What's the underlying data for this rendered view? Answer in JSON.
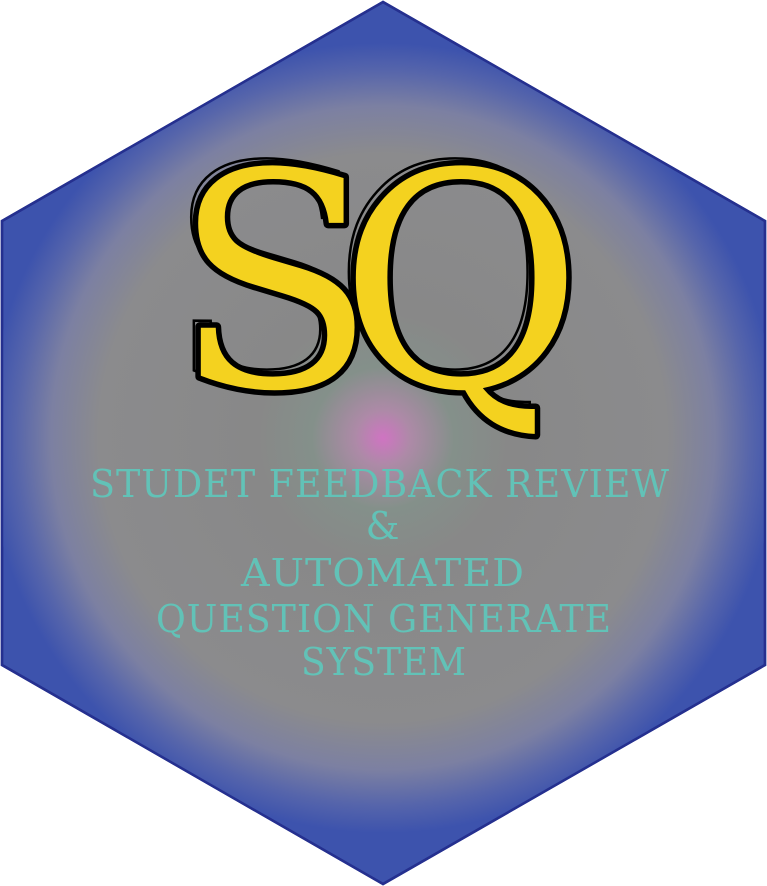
{
  "logo": {
    "letter_1": "S",
    "letter_2": "Q"
  },
  "tagline": {
    "line_1": "STUDET FEEDBACK REVIEW",
    "line_2": "&",
    "line_3": "AUTOMATED",
    "line_4": "QUESTION GENERATE",
    "line_5": "SYSTEM"
  },
  "colors": {
    "hexagon_blue": "#3d53ad",
    "hexagon_stroke": "#25308f",
    "glow_center": "#cf74c2",
    "glow_gray": "#878787",
    "letter_fill": "#f4d21f",
    "letter_outline": "#000000",
    "tagline_teal": "#62c2b7"
  }
}
